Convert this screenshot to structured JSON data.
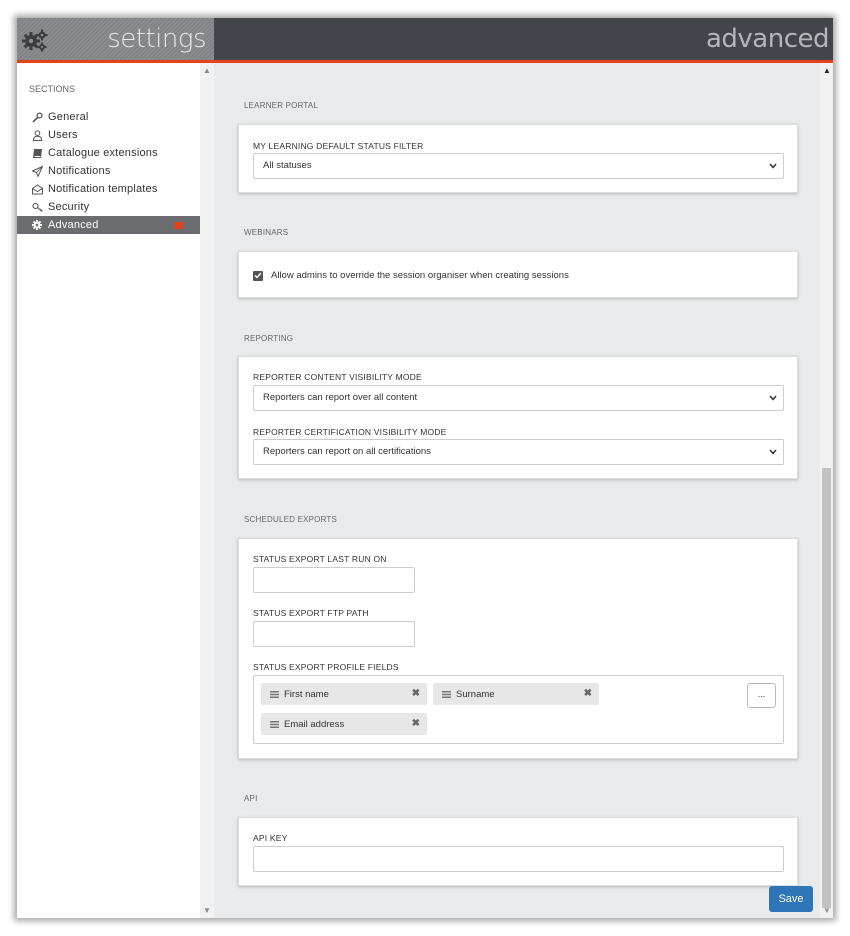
{
  "header": {
    "left_title": "settings",
    "right_title": "advanced",
    "gear_icon": "gears-icon",
    "accent_color": "#e1431e"
  },
  "sidebar": {
    "sections_label": "SECTIONS",
    "items": [
      {
        "label": "General",
        "icon": "wrench-icon"
      },
      {
        "label": "Users",
        "icon": "user-icon"
      },
      {
        "label": "Catalogue extensions",
        "icon": "book-icon"
      },
      {
        "label": "Notifications",
        "icon": "paper-plane-icon"
      },
      {
        "label": "Notification templates",
        "icon": "envelope-icon"
      },
      {
        "label": "Security",
        "icon": "key-icon"
      },
      {
        "label": "Advanced",
        "icon": "gear-icon",
        "active": true
      }
    ]
  },
  "main": {
    "learner_portal": {
      "title": "LEARNER PORTAL",
      "status_filter_label": "MY LEARNING DEFAULT STATUS FILTER",
      "status_filter_value": "All statuses"
    },
    "webinars": {
      "title": "WEBINARS",
      "override_label": "Allow admins to override the session organiser when creating sessions",
      "override_checked": true
    },
    "reporting": {
      "title": "REPORTING",
      "content_label": "REPORTER CONTENT VISIBILITY MODE",
      "content_value": "Reporters can report over all content",
      "cert_label": "REPORTER CERTIFICATION VISIBILITY MODE",
      "cert_value": "Reporters can report on all certifications"
    },
    "scheduled_exports": {
      "title": "SCHEDULED EXPORTS",
      "last_run_label": "STATUS EXPORT LAST RUN ON",
      "last_run_value": "",
      "ftp_label": "STATUS EXPORT FTP PATH",
      "ftp_value": "",
      "profile_fields_label": "STATUS EXPORT PROFILE FIELDS",
      "profile_fields": [
        "First name",
        "Surname",
        "Email address"
      ],
      "more_button": "..."
    },
    "api": {
      "title": "API",
      "key_label": "API KEY",
      "key_value": ""
    },
    "save_label": "Save"
  }
}
